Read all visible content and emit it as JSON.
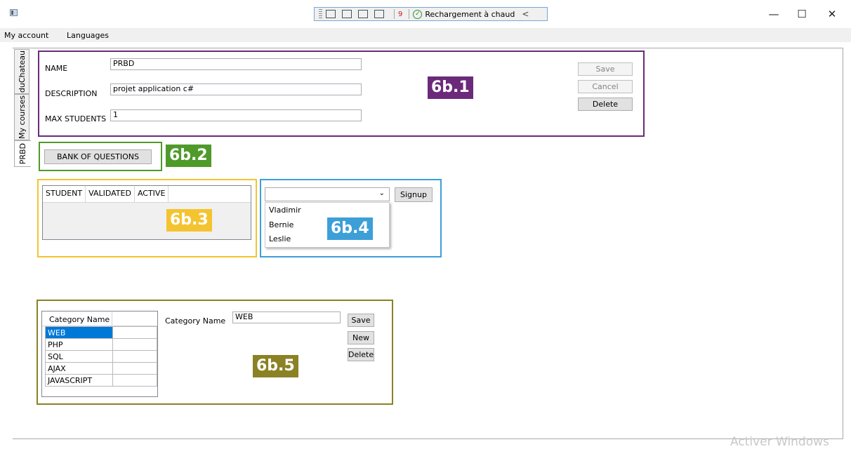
{
  "devbar": {
    "error_count": "9",
    "hot_reload": "Rechargement à chaud",
    "chevron": "<"
  },
  "window_controls": {
    "minimize": "—",
    "maximize": "☐",
    "close": "✕"
  },
  "menu": {
    "items": [
      "My account",
      "Languages"
    ]
  },
  "tabs": [
    "duChateau",
    "My courses",
    "PRBD"
  ],
  "course_form": {
    "name_label": "NAME",
    "name_value": "PRBD",
    "description_label": "DESCRIPTION",
    "description_value": "projet application c#",
    "max_students_label": "MAX STUDENTS",
    "max_students_value": "1",
    "save_label": "Save",
    "cancel_label": "Cancel",
    "delete_label": "Delete"
  },
  "bank_button": "BANK OF QUESTIONS",
  "students_grid": {
    "headers": [
      "STUDENT",
      "VALIDATED",
      "ACTIVE"
    ]
  },
  "signup": {
    "button": "Signup",
    "options": [
      "Vladimir",
      "Bernie",
      "Leslie"
    ]
  },
  "categories": {
    "header": "Category Name",
    "rows": [
      "WEB",
      "PHP",
      "SQL",
      "AJAX",
      "JAVASCRIPT"
    ],
    "selected_index": 0,
    "field_label": "Category Name",
    "field_value": "WEB",
    "save_label": "Save",
    "new_label": "New",
    "delete_label": "Delete"
  },
  "annotations": {
    "a1": "6b.1",
    "a2": "6b.2",
    "a3": "6b.3",
    "a4": "6b.4",
    "a5": "6b.5"
  },
  "colors": {
    "purple": "#6b2a7a",
    "green": "#4f9a2a",
    "yellow": "#f4c430",
    "blue": "#3d9fd8",
    "olive": "#8a8224",
    "selection": "#0078d7"
  },
  "watermark": "Activer Windows"
}
